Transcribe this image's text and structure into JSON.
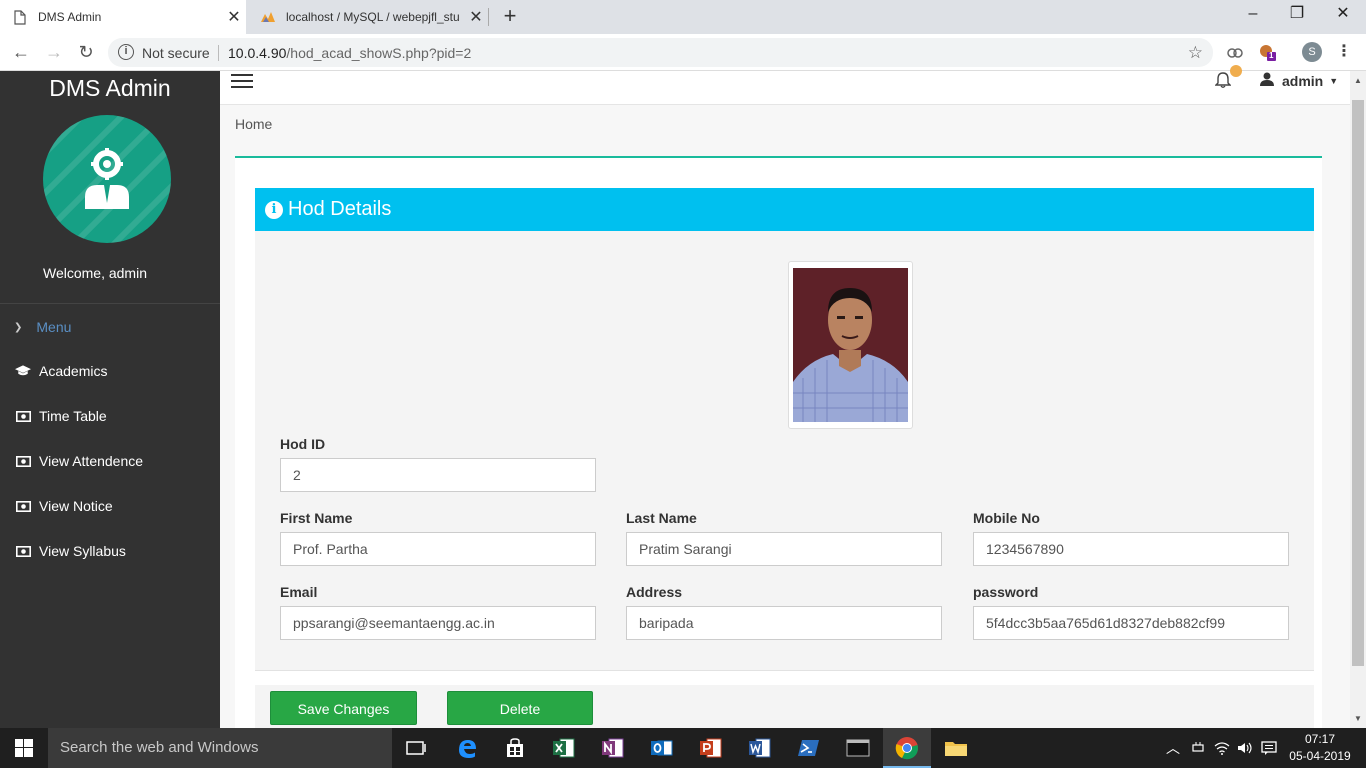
{
  "browser": {
    "tabs": [
      {
        "title": "DMS Admin",
        "active": true
      },
      {
        "title": "localhost / MySQL / webepjfl_stu",
        "active": false
      }
    ],
    "security_label": "Not secure",
    "url_host": "10.0.4.90",
    "url_path": "/hod_acad_showS.php?pid=2",
    "profile_initial": "S",
    "extension_badge": "1"
  },
  "sidebar": {
    "brand": "DMS Admin",
    "welcome": "Welcome, admin",
    "menu_label": "Menu",
    "items": [
      {
        "label": "Academics",
        "icon": "graduation-cap-icon"
      },
      {
        "label": "Time Table",
        "icon": "money-icon"
      },
      {
        "label": "View Attendence",
        "icon": "money-icon"
      },
      {
        "label": "View Notice",
        "icon": "money-icon"
      },
      {
        "label": "View Syllabus",
        "icon": "money-icon"
      }
    ]
  },
  "topbar": {
    "user_name": "admin"
  },
  "breadcrumb": "Home",
  "panel": {
    "title": "Hod Details",
    "header_color": "#00c0ef",
    "fields": {
      "hod_id": {
        "label": "Hod ID",
        "value": "2"
      },
      "first_name": {
        "label": "First Name",
        "value": "Prof. Partha"
      },
      "last_name": {
        "label": "Last Name",
        "value": "Pratim Sarangi"
      },
      "mobile": {
        "label": "Mobile No",
        "value": "1234567890"
      },
      "email": {
        "label": "Email",
        "value": "ppsarangi@seemantaengg.ac.in"
      },
      "address": {
        "label": "Address",
        "value": "baripada"
      },
      "password": {
        "label": "password",
        "value": "5f4dcc3b5aa765d61d8327deb882cf99"
      }
    },
    "buttons": {
      "save": "Save Changes",
      "delete": "Delete"
    },
    "button_color": "#28a745"
  },
  "taskbar": {
    "search_placeholder": "Search the web and Windows",
    "time": "07:17",
    "date": "05-04-2019"
  }
}
